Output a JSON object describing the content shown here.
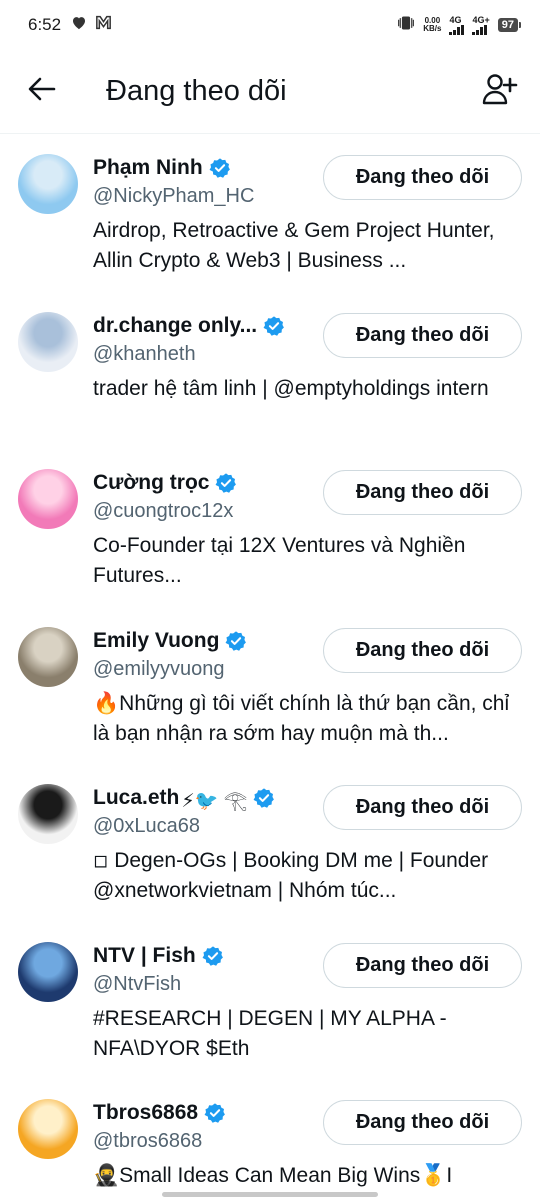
{
  "status_bar": {
    "time": "6:52",
    "net_speed_value": "0.00",
    "net_speed_unit": "KB/s",
    "net1": "4G",
    "net2": "4G+",
    "battery": "97",
    "icons": [
      "heart-icon",
      "m-app-icon",
      "vibrate-icon"
    ]
  },
  "header": {
    "title": "Đang theo dõi",
    "back_icon": "back-arrow-icon",
    "add_icon": "add-user-icon"
  },
  "follow_label": "Đang theo dõi",
  "users": [
    {
      "name": "Phạm Ninh",
      "extra": "",
      "handle": "@NickyPham_HC",
      "bio": "Airdrop, Retroactive & Gem Project Hunter, Allin Crypto & Web3 | Business ...",
      "avatar_colors": [
        "#8ec9f0",
        "#d8ebf7"
      ]
    },
    {
      "name": "dr.change only...",
      "extra": "",
      "handle": "@khanheth",
      "bio": "trader hệ tâm linh | @emptyholdings intern",
      "avatar_colors": [
        "#e9eef5",
        "#a9c0da"
      ]
    },
    {
      "name": "Cường trọc",
      "extra": "",
      "handle": "@cuongtroc12x",
      "bio": "Co-Founder tại 12X Ventures và Nghiền Futures...",
      "avatar_colors": [
        "#f27ab8",
        "#ffd1e6"
      ]
    },
    {
      "name": "Emily Vuong",
      "extra": "",
      "handle": "@emilyyvuong",
      "bio": "🔥Những gì tôi viết chính là thứ bạn cần, chỉ là bạn nhận ra sớm hay muộn mà th...",
      "avatar_colors": [
        "#8a7f6c",
        "#d9d2c3"
      ]
    },
    {
      "name": "Luca.eth",
      "extra": "⚡🐦 𓂀",
      "handle": "@0xLuca68",
      "bio": "◽ Degen-OGs | Booking DM me | Founder @xnetworkvietnam | Nhóm túc...",
      "avatar_colors": [
        "#f2f2f2",
        "#1a1a1a"
      ]
    },
    {
      "name": "NTV | Fish",
      "extra": "",
      "handle": "@NtvFish",
      "bio": "#RESEARCH | DEGEN | MY ALPHA - NFA\\DYOR $Eth",
      "avatar_colors": [
        "#1e3a6e",
        "#6fa8e0"
      ]
    },
    {
      "name": "Tbros6868",
      "extra": "",
      "handle": "@tbros6868",
      "bio": "🥷Small Ideas Can Mean Big Wins🥇I",
      "avatar_colors": [
        "#f5a623",
        "#fff0c9"
      ]
    }
  ]
}
